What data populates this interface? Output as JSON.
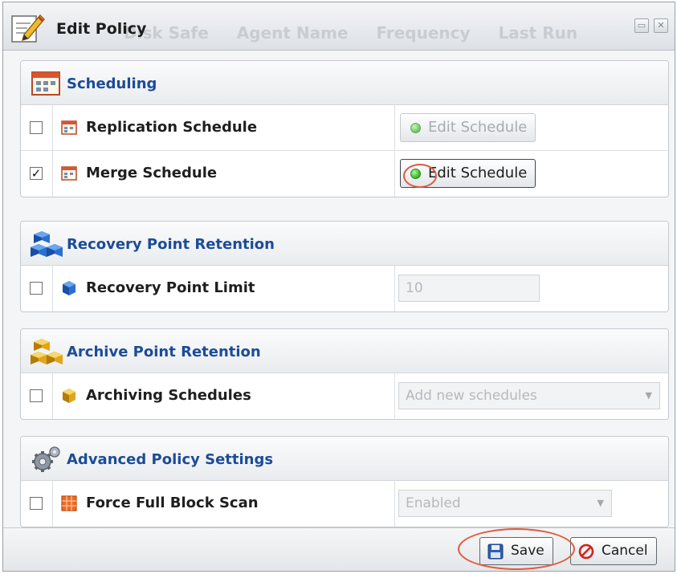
{
  "dialog": {
    "title": "Edit Policy",
    "background_columns": [
      "Disk Safe",
      "Agent Name",
      "Frequency",
      "Last Run"
    ],
    "title_icon": "edit-policy-icon",
    "window_buttons": [
      "maximize-icon",
      "close-icon"
    ]
  },
  "sections": {
    "scheduling": {
      "title": "Scheduling",
      "icon": "calendar-icon",
      "rows": [
        {
          "label": "Replication Schedule",
          "checked": false,
          "button": "Edit Schedule",
          "enabled": false
        },
        {
          "label": "Merge Schedule",
          "checked": true,
          "button": "Edit Schedule",
          "enabled": true
        }
      ]
    },
    "recovery": {
      "title": "Recovery Point Retention",
      "icon": "blue-cubes-icon",
      "rows": [
        {
          "label": "Recovery Point Limit",
          "checked": false,
          "value": "10"
        }
      ]
    },
    "archive": {
      "title": "Archive Point Retention",
      "icon": "gold-cubes-icon",
      "rows": [
        {
          "label": "Archiving Schedules",
          "checked": false,
          "value": "Add new schedules"
        }
      ]
    },
    "advanced": {
      "title": "Advanced Policy Settings",
      "icon": "gears-icon",
      "rows": [
        {
          "label": "Force Full Block Scan",
          "checked": false,
          "value": "Enabled"
        }
      ]
    }
  },
  "footer": {
    "save_label": "Save",
    "cancel_label": "Cancel"
  },
  "colors": {
    "section_title": "#1d4c97",
    "highlight": "#e05a3c",
    "status_green": "#3fbf33"
  },
  "glyphs": {
    "checkmark": "✓",
    "dropdown_arrow": "▼"
  }
}
